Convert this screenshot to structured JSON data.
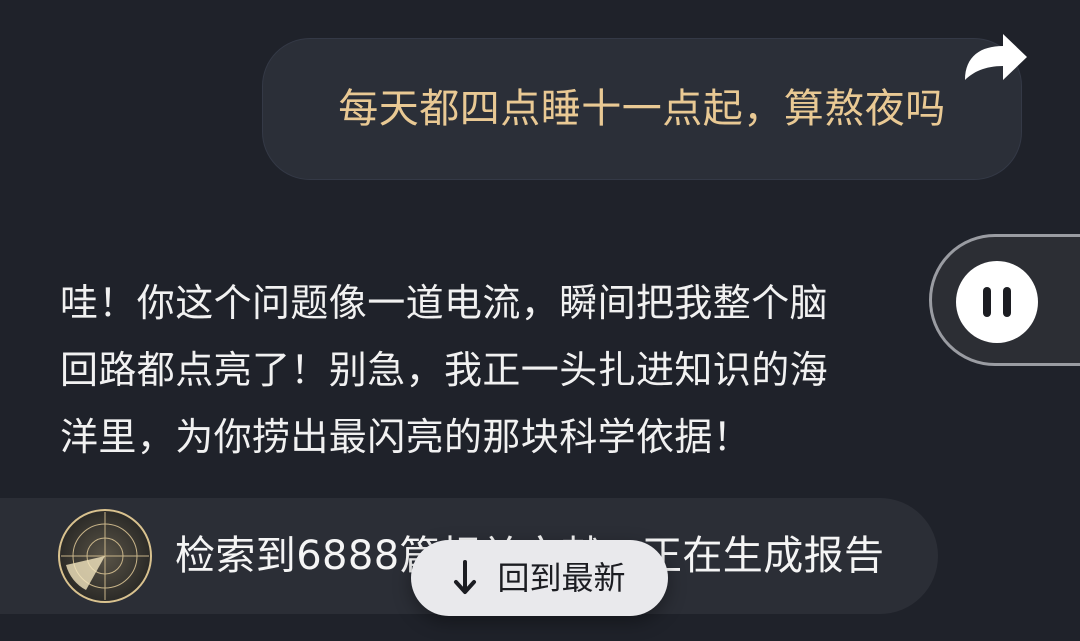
{
  "chat": {
    "user_message": "每天都四点睡十一点起，算熬夜吗",
    "assistant_message": "哇！你这个问题像一道电流，瞬间把我整个脑\n回路都点亮了！别急，我正一头扎进知识的海\n洋里，为你捞出最闪亮的那块科学依据！"
  },
  "status": {
    "text": "检索到6888篇相关文献，正在生成报告"
  },
  "controls": {
    "back_to_latest_label": "回到最新",
    "pause_icon": "pause-icon",
    "share_icon": "share-arrow-icon",
    "radar_icon": "radar-icon",
    "down_icon": "down-arrow-icon"
  },
  "colors": {
    "background": "#1f222a",
    "user_text": "#e9c994",
    "assistant_text": "#f1f1f1",
    "bubble": "#2b2f38"
  }
}
